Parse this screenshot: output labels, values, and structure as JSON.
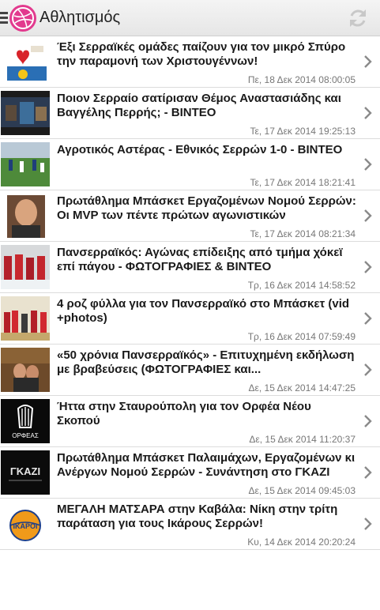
{
  "header": {
    "title": "Αθλητισμός",
    "menu_icon": "hamburger-icon",
    "logo_icon": "dribbble-logo-icon",
    "refresh_icon": "refresh-icon"
  },
  "colors": {
    "accent": "#e23a8e",
    "headline": "#1a1a1a",
    "date": "#777777"
  },
  "items": [
    {
      "headline": "Έξι Σερραϊκές ομάδες παίζουν για τον μικρό Σπύρο την παραμονή των Χριστουγέννων!",
      "date": "Πε, 18 Δεκ 2014 08:00:05"
    },
    {
      "headline": "Ποιον Σερραίο σατίρισαν Θέμος Αναστασιάδης και Βαγγέλης Περρής; - ΒΙΝΤΕΟ",
      "date": "Τε, 17 Δεκ 2014 19:25:13"
    },
    {
      "headline": "Αγροτικός Αστέρας - Εθνικός Σερρών 1-0 - ΒΙΝΤΕΟ",
      "date": "Τε, 17 Δεκ 2014 18:21:41"
    },
    {
      "headline": "Πρωτάθλημα Μπάσκετ Εργαζομένων Νομού Σερρών: Οι MVP των πέντε πρώτων αγωνιστικών",
      "date": "Τε, 17 Δεκ 2014 08:21:34"
    },
    {
      "headline": "Πανσερραϊκός: Αγώνας επίδειξης από τμήμα χόκεϊ επί πάγου - ΦΩΤΟΓΡΑΦΙΕΣ & ΒΙΝΤΕΟ",
      "date": "Τρ, 16 Δεκ 2014 14:58:52"
    },
    {
      "headline": "4 ροζ φύλλα για τον Πανσερραϊκό στο Μπάσκετ (vid +photos)",
      "date": "Τρ, 16 Δεκ 2014 07:59:49"
    },
    {
      "headline": "«50 χρόνια Πανσερραϊκός» - Επιτυχημένη εκδήλωση με βραβεύσεις (ΦΩΤΟΓΡΑΦΙΕΣ και...",
      "date": "Δε, 15 Δεκ 2014 14:47:25"
    },
    {
      "headline": "Ήττα στην Σταυρούπολη για τον Ορφέα Νέου Σκοπού",
      "date": "Δε, 15 Δεκ 2014 11:20:37"
    },
    {
      "headline": "Πρωτάθλημα Μπάσκετ Παλαιμάχων, Εργαζομένων κι Ανέργων Νομού Σερρών - Συνάντηση στο ΓΚΑΖΙ",
      "date": "Δε, 15 Δεκ 2014 09:45:03"
    },
    {
      "headline": "ΜΕΓΑΛΗ ΜΑΤΣΑΡΑ στην Καβάλα: Νίκη στην τρίτη παράταση για τους Ικάρους Σερρών!",
      "date": "Κυ, 14 Δεκ 2014 20:20:24"
    }
  ],
  "thumb_text": {
    "orfeas": "ΟΡΦΕΑΣ",
    "gkazi": "ΓΚΑΖΙ",
    "ikaroi": "ΙΚΑΡΟΙ"
  }
}
